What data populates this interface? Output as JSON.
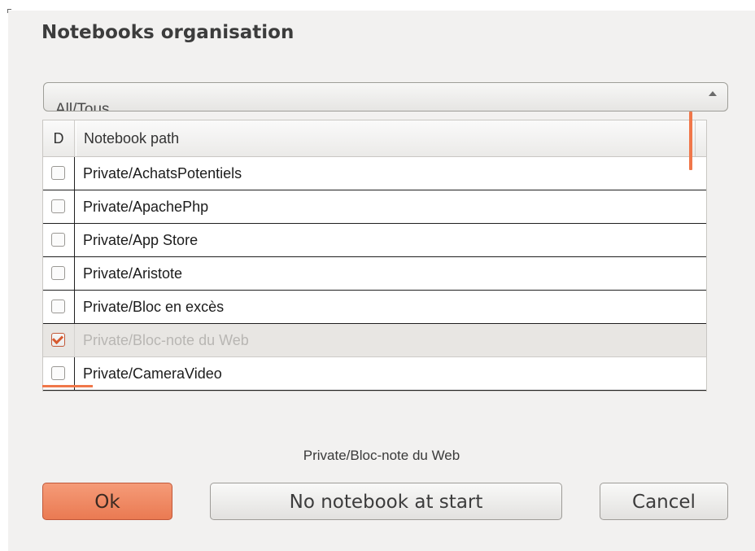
{
  "dialog": {
    "title": "Notebooks organisation"
  },
  "filter_combo": {
    "selected": "All/Tous"
  },
  "table": {
    "columns": [
      "D",
      "Notebook path"
    ],
    "rows": [
      {
        "checked": false,
        "path": "Private/AchatsPotentiels"
      },
      {
        "checked": false,
        "path": "Private/ApachePhp"
      },
      {
        "checked": false,
        "path": "Private/App Store"
      },
      {
        "checked": false,
        "path": "Private/Aristote"
      },
      {
        "checked": false,
        "path": "Private/Bloc en excès"
      },
      {
        "checked": true,
        "path": "Private/Bloc-note du Web",
        "selected": true
      },
      {
        "checked": false,
        "path": "Private/CameraVideo"
      }
    ]
  },
  "status": {
    "selected_path": "Private/Bloc-note du Web"
  },
  "buttons": {
    "ok": "Ok",
    "no_notebook": "No notebook at start",
    "cancel": "Cancel"
  },
  "colors": {
    "accent": "#f0774a",
    "ok_button": "#ea7a52"
  }
}
